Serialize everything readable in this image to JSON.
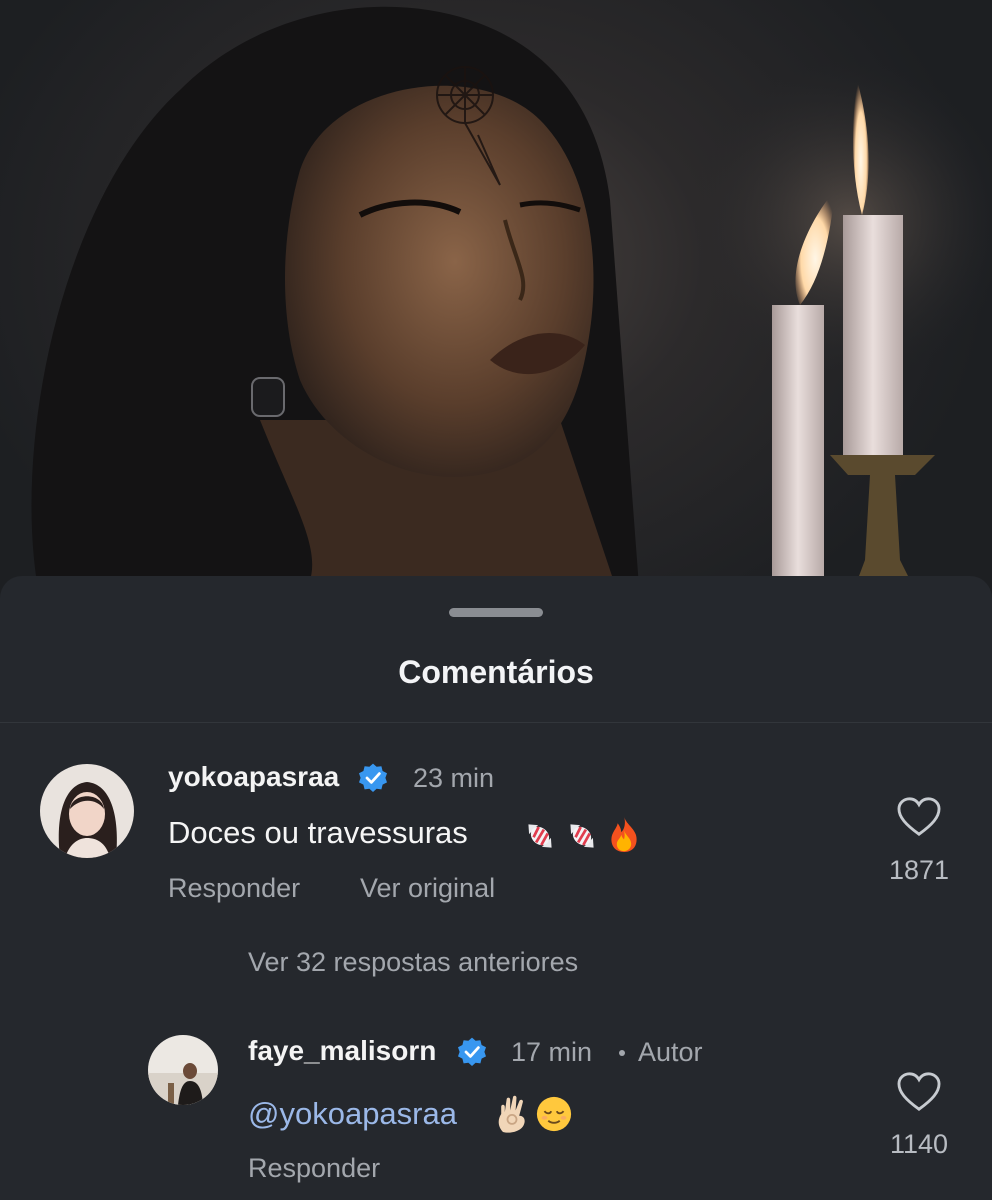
{
  "sheet": {
    "title": "Comentários"
  },
  "comments": [
    {
      "username": "yokoapasraa",
      "time": "23 min",
      "text": "Doces ou travessuras",
      "emojis": [
        "candy-icon",
        "candy-icon",
        "fire-icon"
      ],
      "reply_label": "Responder",
      "see_original_label": "Ver original",
      "likes": "1871"
    }
  ],
  "view_replies_label": "Ver 32 respostas anteriores",
  "reply": {
    "username": "faye_malisorn",
    "time": "17 min",
    "author_badge": "Autor",
    "mention": "@yokoapasraa",
    "emojis": [
      "ok-hand-icon",
      "relieved-face-icon"
    ],
    "reply_label": "Responder",
    "likes": "1140"
  },
  "colors": {
    "sheet_bg": "#25282d",
    "verified_blue": "#3897f0",
    "mention_blue": "#9bb8e8",
    "secondary_text": "#a3a7ad"
  }
}
